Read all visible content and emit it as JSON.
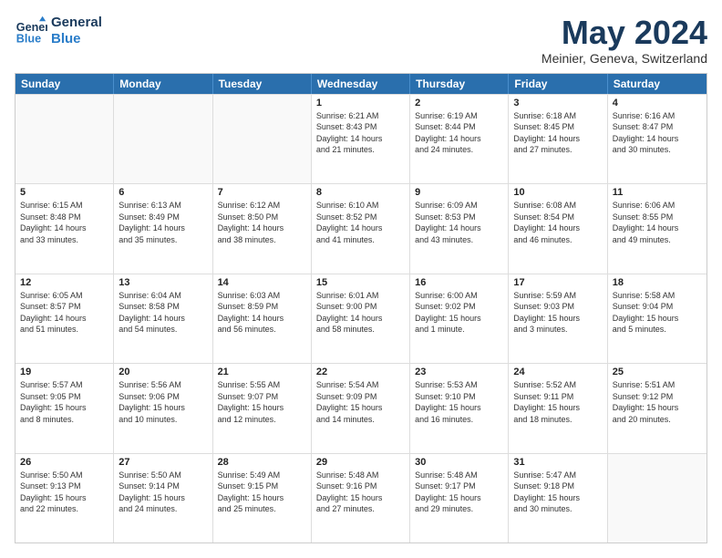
{
  "logo": {
    "line1": "General",
    "line2": "Blue"
  },
  "title": "May 2024",
  "location": "Meinier, Geneva, Switzerland",
  "days_header": [
    "Sunday",
    "Monday",
    "Tuesday",
    "Wednesday",
    "Thursday",
    "Friday",
    "Saturday"
  ],
  "weeks": [
    [
      {
        "day": "",
        "info": ""
      },
      {
        "day": "",
        "info": ""
      },
      {
        "day": "",
        "info": ""
      },
      {
        "day": "1",
        "info": "Sunrise: 6:21 AM\nSunset: 8:43 PM\nDaylight: 14 hours\nand 21 minutes."
      },
      {
        "day": "2",
        "info": "Sunrise: 6:19 AM\nSunset: 8:44 PM\nDaylight: 14 hours\nand 24 minutes."
      },
      {
        "day": "3",
        "info": "Sunrise: 6:18 AM\nSunset: 8:45 PM\nDaylight: 14 hours\nand 27 minutes."
      },
      {
        "day": "4",
        "info": "Sunrise: 6:16 AM\nSunset: 8:47 PM\nDaylight: 14 hours\nand 30 minutes."
      }
    ],
    [
      {
        "day": "5",
        "info": "Sunrise: 6:15 AM\nSunset: 8:48 PM\nDaylight: 14 hours\nand 33 minutes."
      },
      {
        "day": "6",
        "info": "Sunrise: 6:13 AM\nSunset: 8:49 PM\nDaylight: 14 hours\nand 35 minutes."
      },
      {
        "day": "7",
        "info": "Sunrise: 6:12 AM\nSunset: 8:50 PM\nDaylight: 14 hours\nand 38 minutes."
      },
      {
        "day": "8",
        "info": "Sunrise: 6:10 AM\nSunset: 8:52 PM\nDaylight: 14 hours\nand 41 minutes."
      },
      {
        "day": "9",
        "info": "Sunrise: 6:09 AM\nSunset: 8:53 PM\nDaylight: 14 hours\nand 43 minutes."
      },
      {
        "day": "10",
        "info": "Sunrise: 6:08 AM\nSunset: 8:54 PM\nDaylight: 14 hours\nand 46 minutes."
      },
      {
        "day": "11",
        "info": "Sunrise: 6:06 AM\nSunset: 8:55 PM\nDaylight: 14 hours\nand 49 minutes."
      }
    ],
    [
      {
        "day": "12",
        "info": "Sunrise: 6:05 AM\nSunset: 8:57 PM\nDaylight: 14 hours\nand 51 minutes."
      },
      {
        "day": "13",
        "info": "Sunrise: 6:04 AM\nSunset: 8:58 PM\nDaylight: 14 hours\nand 54 minutes."
      },
      {
        "day": "14",
        "info": "Sunrise: 6:03 AM\nSunset: 8:59 PM\nDaylight: 14 hours\nand 56 minutes."
      },
      {
        "day": "15",
        "info": "Sunrise: 6:01 AM\nSunset: 9:00 PM\nDaylight: 14 hours\nand 58 minutes."
      },
      {
        "day": "16",
        "info": "Sunrise: 6:00 AM\nSunset: 9:02 PM\nDaylight: 15 hours\nand 1 minute."
      },
      {
        "day": "17",
        "info": "Sunrise: 5:59 AM\nSunset: 9:03 PM\nDaylight: 15 hours\nand 3 minutes."
      },
      {
        "day": "18",
        "info": "Sunrise: 5:58 AM\nSunset: 9:04 PM\nDaylight: 15 hours\nand 5 minutes."
      }
    ],
    [
      {
        "day": "19",
        "info": "Sunrise: 5:57 AM\nSunset: 9:05 PM\nDaylight: 15 hours\nand 8 minutes."
      },
      {
        "day": "20",
        "info": "Sunrise: 5:56 AM\nSunset: 9:06 PM\nDaylight: 15 hours\nand 10 minutes."
      },
      {
        "day": "21",
        "info": "Sunrise: 5:55 AM\nSunset: 9:07 PM\nDaylight: 15 hours\nand 12 minutes."
      },
      {
        "day": "22",
        "info": "Sunrise: 5:54 AM\nSunset: 9:09 PM\nDaylight: 15 hours\nand 14 minutes."
      },
      {
        "day": "23",
        "info": "Sunrise: 5:53 AM\nSunset: 9:10 PM\nDaylight: 15 hours\nand 16 minutes."
      },
      {
        "day": "24",
        "info": "Sunrise: 5:52 AM\nSunset: 9:11 PM\nDaylight: 15 hours\nand 18 minutes."
      },
      {
        "day": "25",
        "info": "Sunrise: 5:51 AM\nSunset: 9:12 PM\nDaylight: 15 hours\nand 20 minutes."
      }
    ],
    [
      {
        "day": "26",
        "info": "Sunrise: 5:50 AM\nSunset: 9:13 PM\nDaylight: 15 hours\nand 22 minutes."
      },
      {
        "day": "27",
        "info": "Sunrise: 5:50 AM\nSunset: 9:14 PM\nDaylight: 15 hours\nand 24 minutes."
      },
      {
        "day": "28",
        "info": "Sunrise: 5:49 AM\nSunset: 9:15 PM\nDaylight: 15 hours\nand 25 minutes."
      },
      {
        "day": "29",
        "info": "Sunrise: 5:48 AM\nSunset: 9:16 PM\nDaylight: 15 hours\nand 27 minutes."
      },
      {
        "day": "30",
        "info": "Sunrise: 5:48 AM\nSunset: 9:17 PM\nDaylight: 15 hours\nand 29 minutes."
      },
      {
        "day": "31",
        "info": "Sunrise: 5:47 AM\nSunset: 9:18 PM\nDaylight: 15 hours\nand 30 minutes."
      },
      {
        "day": "",
        "info": ""
      }
    ]
  ]
}
